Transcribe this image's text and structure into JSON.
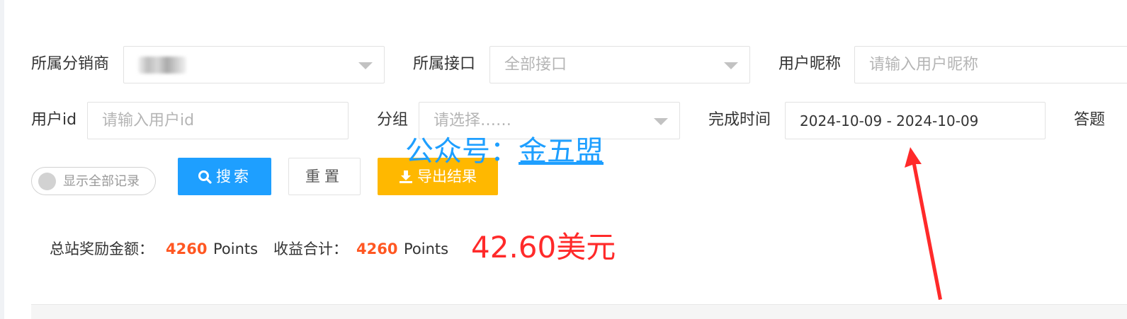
{
  "filters": {
    "distributor": {
      "label": "所属分销商"
    },
    "interface": {
      "label": "所属接口",
      "value": "全部接口"
    },
    "nickname": {
      "label": "用户昵称",
      "placeholder": "请输入用户昵称"
    },
    "user_id": {
      "label": "用户id",
      "placeholder": "请输入用户id"
    },
    "group": {
      "label": "分组",
      "placeholder": "请选择……"
    },
    "complete_time": {
      "label": "完成时间",
      "value": "2024-10-09 - 2024-10-09"
    },
    "answer_cut": {
      "label": "答题"
    }
  },
  "actions": {
    "show_all": "显示全部记录",
    "search": "搜索",
    "reset": "重置",
    "export": "导出结果"
  },
  "watermark": {
    "prefix": "公众号：",
    "name": "金五盟"
  },
  "summary": {
    "total_reward_label": "总站奖励金额：",
    "total_reward_value": "4260",
    "total_reward_unit": "Points",
    "income_label": "收益合计：",
    "income_value": "4260",
    "income_unit": "Points",
    "usd_amount": "42.60美元"
  },
  "colors": {
    "primary": "#1e9fff",
    "warning": "#ffb800",
    "highlight": "#ff5722",
    "annotation_red": "#ff2a2a"
  },
  "icons": {
    "search": "search-icon",
    "export": "download-icon",
    "dropdown": "chevron-down-icon",
    "annotation": "red-arrow-icon"
  }
}
